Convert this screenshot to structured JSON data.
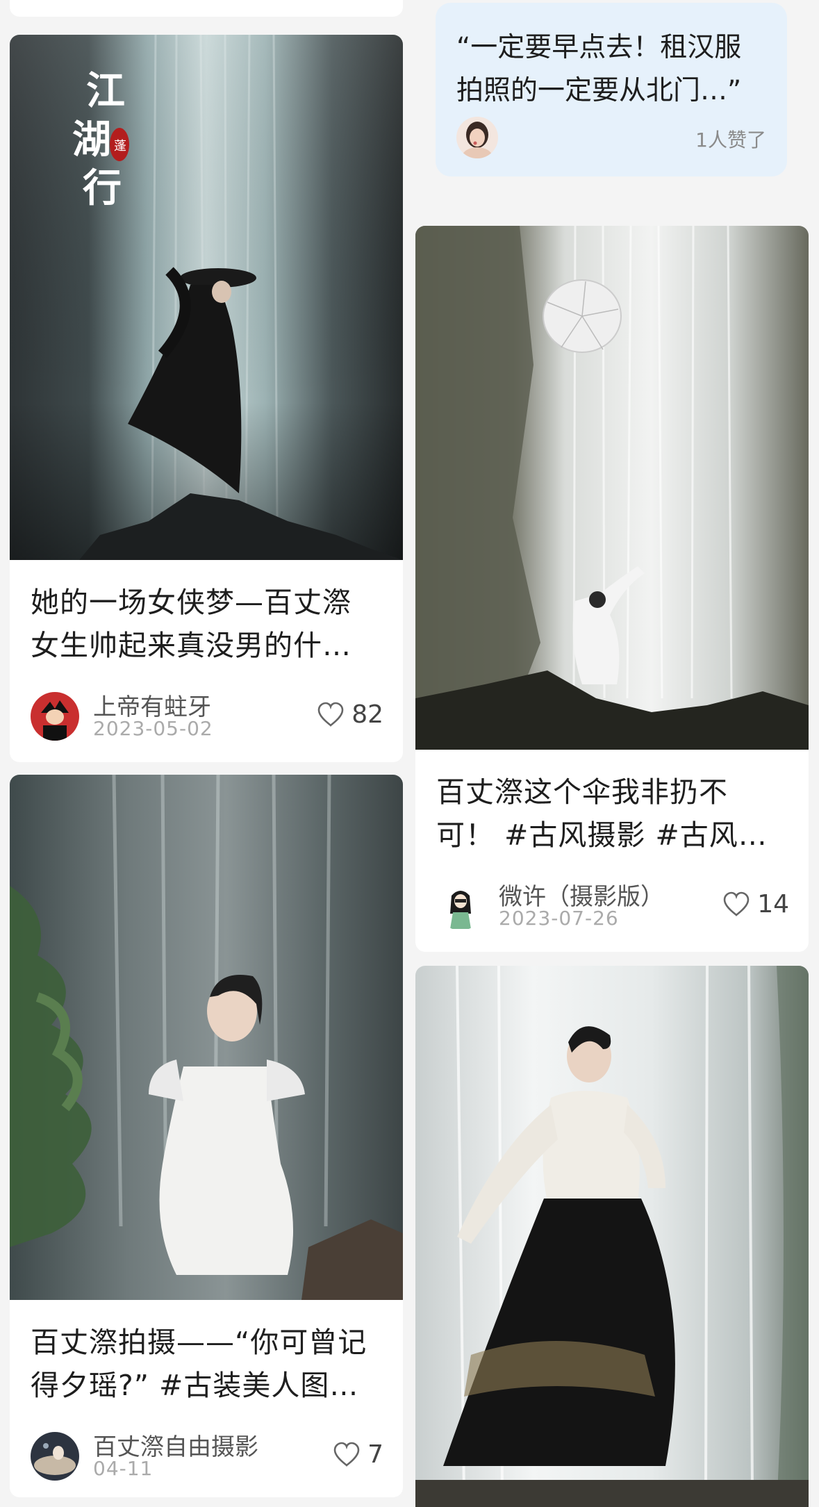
{
  "quote_card": {
    "line1": "“一定要早点去！租汉服",
    "line2": "拍照的一定要从北门…”",
    "likes_text": "1人赞了"
  },
  "posts": [
    {
      "title_line1": "她的一场女侠梦—百丈漈",
      "title_line2": "女生帅起来真没男的什…",
      "author": "上帝有蛀牙",
      "date": "2023-05-02",
      "likes": "82",
      "overlay_text": "江湖行",
      "seal_text": "蓬"
    },
    {
      "title_line1": "百丈漈这个伞我非扔不",
      "title_line2": "可！ #古风摄影 #古风…",
      "author": "微许（摄影版）",
      "date": "2023-07-26",
      "likes": "14"
    },
    {
      "title_line1": "百丈漈拍摄——“你可曾记",
      "title_line2": "得夕瑶?” #古装美人图…",
      "author": "百丈漈自由摄影",
      "date": "04-11",
      "likes": "7"
    },
    {}
  ],
  "colors": {
    "background": "#f4f4f4",
    "quote_bg": "#e6f1fb",
    "title": "#1e1e1e",
    "meta": "#aaaaaa"
  }
}
